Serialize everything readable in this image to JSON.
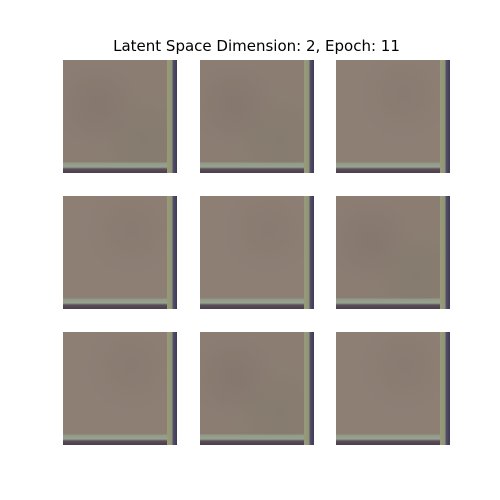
{
  "figure": {
    "title": "Latent Space Dimension: 2, Epoch: 11",
    "grid": {
      "rows": 3,
      "cols": 3
    },
    "tile_color": "#8b7d72"
  }
}
